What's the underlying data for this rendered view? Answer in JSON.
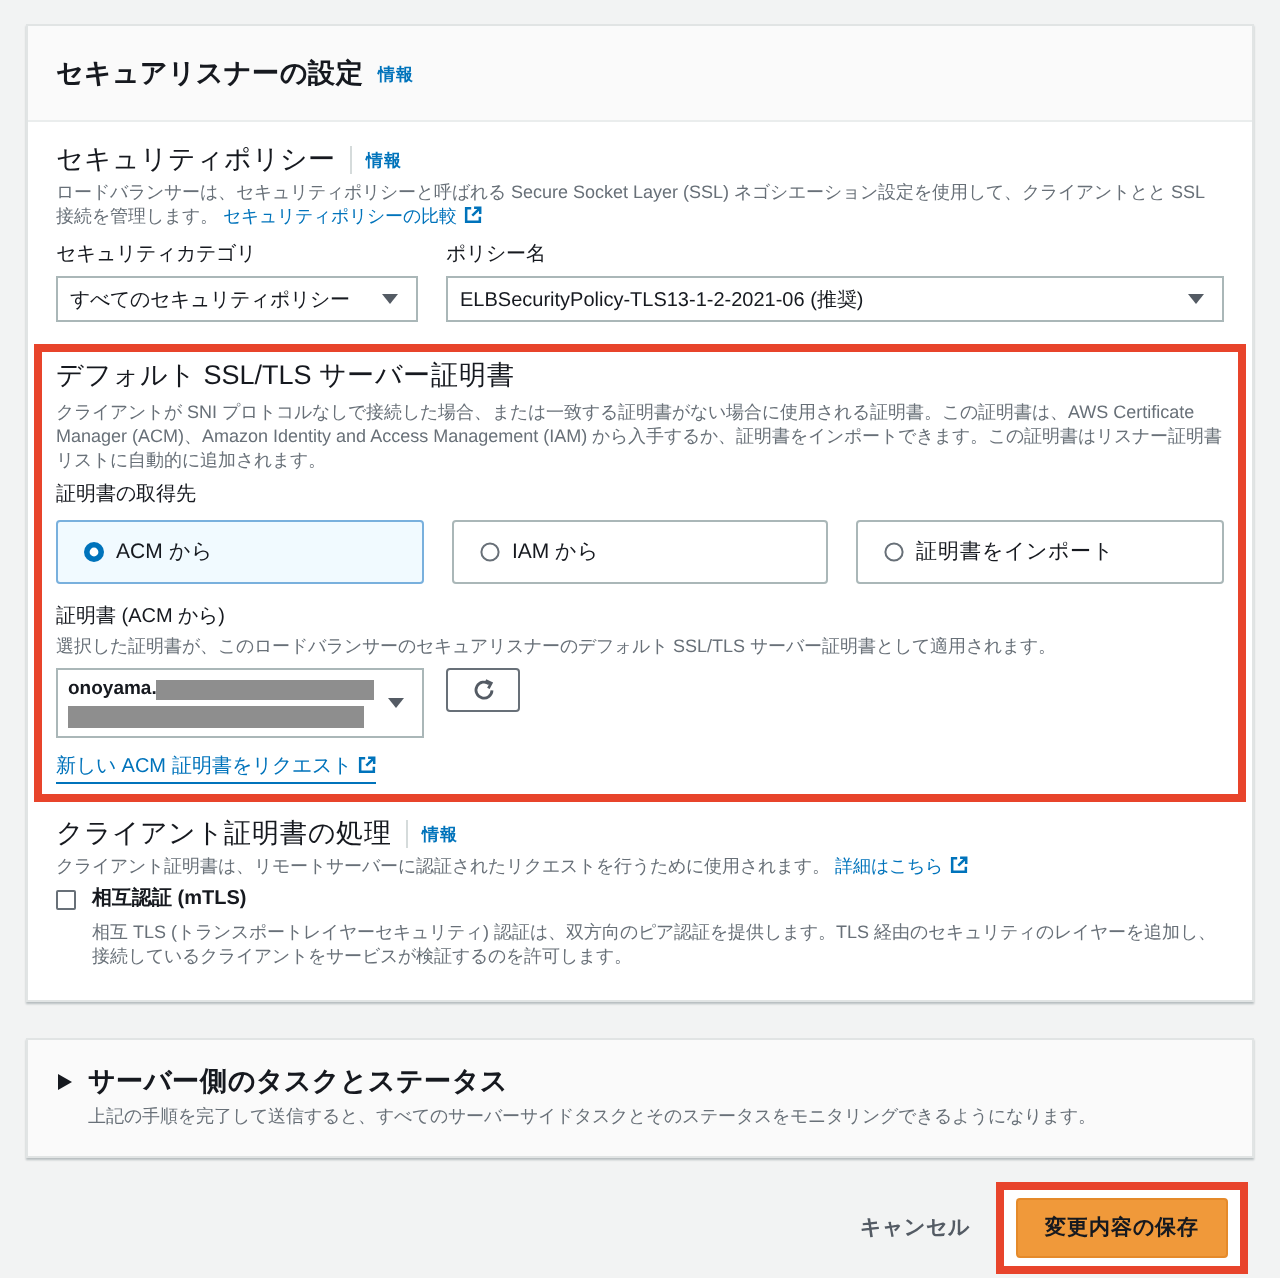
{
  "section": {
    "title": "セキュアリスナーの設定",
    "info": "情報"
  },
  "security_policy": {
    "title": "セキュリティポリシー",
    "info": "情報",
    "description": "ロードバランサーは、セキュリティポリシーと呼ばれる Secure Socket Layer (SSL) ネゴシエーション設定を使用して、クライアントとと SSL 接続を管理します。",
    "link": "セキュリティポリシーの比較",
    "fields": [
      {
        "label": "セキュリティカテゴリ",
        "value": "すべてのセキュリティポリシー"
      },
      {
        "label": "ポリシー名",
        "value": "ELBSecurityPolicy-TLS13-1-2-2021-06 (推奨)"
      }
    ]
  },
  "default_certificate": {
    "highlighted": true,
    "title": "デフォルト SSL/TLS サーバー証明書",
    "description": "クライアントが SNI プロトコルなしで接続した場合、または一致する証明書がない場合に使用される証明書。この証明書は、AWS Certificate Manager (ACM)、Amazon Identity and Access Management (IAM) から入手するか、証明書をインポートできます。この証明書はリスナー証明書リストに自動的に追加されます。",
    "source_label": "証明書の取得先",
    "sources": [
      {
        "label": "ACM から",
        "selected": true
      },
      {
        "label": "IAM から",
        "selected": false
      },
      {
        "label": "証明書をインポート",
        "selected": false
      }
    ],
    "certificate_label": "証明書 (ACM から)",
    "certificate_description": "選択した証明書が、このロードバランサーのセキュアリスナーのデフォルト SSL/TLS サーバー証明書として適用されます。",
    "certificate_value": "onoyama.",
    "certificate_redacted": true,
    "request_link": "新しい ACM 証明書をリクエスト"
  },
  "client_certificate": {
    "title": "クライアント証明書の処理",
    "info": "情報",
    "description": "クライアント証明書は、リモートサーバーに認証されたリクエストを行うために使用されます。",
    "link": "詳細はこちら",
    "mtls": {
      "label": "相互認証 (mTLS)",
      "checked": false,
      "description": "相互 TLS (トランスポートレイヤーセキュリティ) 認証は、双方向のピア認証を提供します。TLS 経由のセキュリティのレイヤーを追加し、接続しているクライアントをサービスが検証するのを許可します。"
    }
  },
  "server_tasks": {
    "title": "サーバー側のタスクとステータス",
    "expanded": false,
    "description": "上記の手順を完了して送信すると、すべてのサーバーサイドタスクとそのステータスをモニタリングできるようになります。"
  },
  "footer": {
    "cancel": "キャンセル",
    "save": {
      "label": "変更内容の保存",
      "highlighted": true
    }
  }
}
